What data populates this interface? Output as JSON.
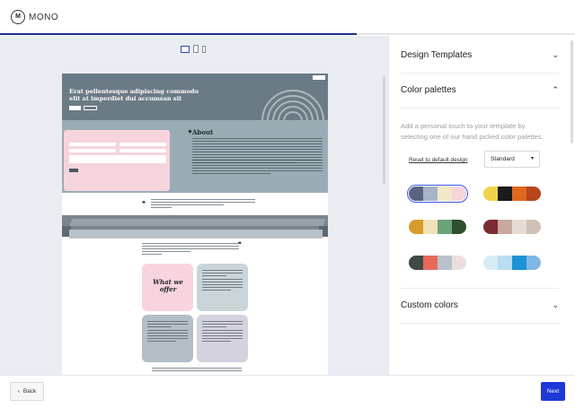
{
  "app": {
    "logo_mark": "M",
    "logo_text": "MONO"
  },
  "progress": {
    "value": 0.62
  },
  "preview": {
    "devices": [
      "desktop",
      "tablet",
      "mobile"
    ],
    "active_device": "desktop"
  },
  "site": {
    "hero_title": "Erat pellentesque adipiscing commodo elit at imperdiet dui accumsan sit",
    "about_title": "About",
    "offer_title": "What we offer",
    "hero_color": "#6b7b85",
    "about_color": "#9aacb3",
    "accent_pink": "#f6d4dc"
  },
  "panel": {
    "design_templates_label": "Design Templates",
    "color_palettes_label": "Color palettes",
    "helper_text": "Add a personal touch to your template by selecting one of our hand picked color palettes.",
    "reset_label": "Reset to default design",
    "select_value": "Standard",
    "custom_colors_label": "Custom colors",
    "palettes": [
      {
        "colors": [
          "#5a6480",
          "#a9b3c8",
          "#f2e7c7",
          "#f6d4dc"
        ],
        "selected": true
      },
      {
        "colors": [
          "#efd44a",
          "#1b1b1b",
          "#e0681f",
          "#b8451c"
        ],
        "selected": false
      },
      {
        "colors": [
          "#d89a2a",
          "#f1e3b7",
          "#6aa37a",
          "#2f4f2f"
        ],
        "selected": false
      },
      {
        "colors": [
          "#7b2b32",
          "#c8a8a0",
          "#e6dcd3",
          "#cfc1b4"
        ],
        "selected": false
      },
      {
        "colors": [
          "#3f4a45",
          "#e8685a",
          "#b9c2cc",
          "#ecdede"
        ],
        "selected": false
      },
      {
        "colors": [
          "#d7ecf7",
          "#b8dcf3",
          "#1c93d6",
          "#7fb8e6"
        ],
        "selected": false
      }
    ]
  },
  "footer": {
    "back_label": "Back",
    "next_label": "Next"
  }
}
